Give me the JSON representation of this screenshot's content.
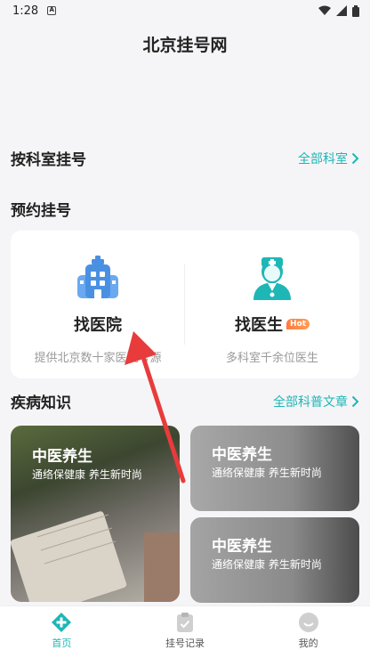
{
  "status_bar": {
    "time": "1:28"
  },
  "app": {
    "title": "北京挂号网"
  },
  "department_section": {
    "title": "按科室挂号",
    "link": "全部科室"
  },
  "appointment_section": {
    "title": "预约挂号",
    "options": [
      {
        "label": "找医院",
        "desc": "提供北京数十家医院号源"
      },
      {
        "label": "找医生",
        "badge": "Hot",
        "desc": "多科室千余位医生"
      }
    ]
  },
  "knowledge_section": {
    "title": "疾病知识",
    "link": "全部科普文章",
    "articles": [
      {
        "title": "中医养生",
        "subtitle": "通络保健康 养生新时尚"
      },
      {
        "title": "中医养生",
        "subtitle": "通络保健康 养生新时尚"
      },
      {
        "title": "中医养生",
        "subtitle": "通络保健康 养生新时尚"
      }
    ]
  },
  "tabs": [
    {
      "label": "首页",
      "active": true
    },
    {
      "label": "挂号记录",
      "active": false
    },
    {
      "label": "我的",
      "active": false
    }
  ],
  "colors": {
    "accent": "#1fb6b6",
    "hot": "#ff7a3d",
    "hospital_icon": "#4a90e2",
    "doctor_icon": "#1fb6b6"
  }
}
